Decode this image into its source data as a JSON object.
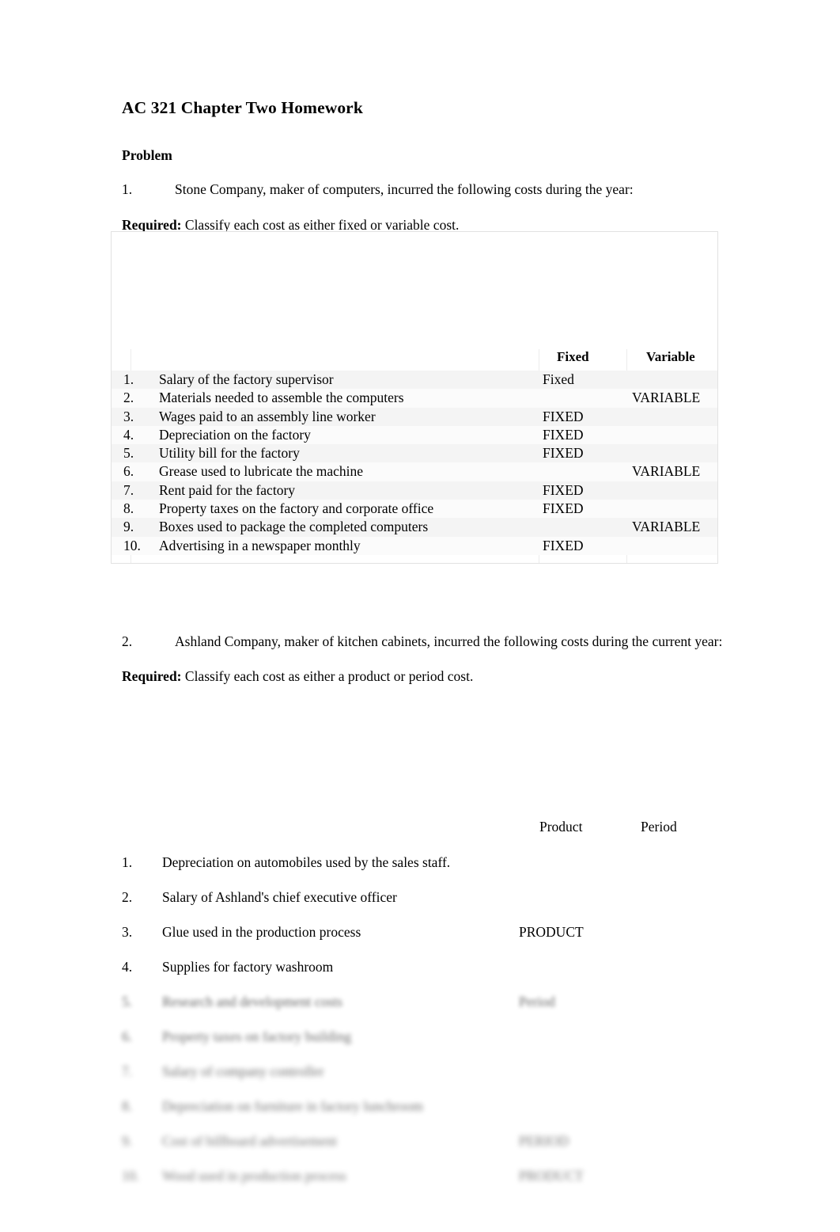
{
  "document": {
    "title": "AC 321 Chapter Two Homework",
    "section_label": "Problem"
  },
  "problem1": {
    "number": "1.",
    "prompt": "Stone Company, maker of computers, incurred the following costs during the year:",
    "required_label": "Required:",
    "required_text": " Classify each cost as either fixed or variable cost.",
    "table": {
      "columns": [
        "Fixed",
        "Variable"
      ],
      "rows": [
        {
          "num": "1.",
          "label": "Salary of the factory supervisor",
          "fixed": "Fixed",
          "variable": ""
        },
        {
          "num": "2.",
          "label": "Materials needed to assemble the computers",
          "fixed": "",
          "variable": "VARIABLE"
        },
        {
          "num": "3.",
          "label": "Wages paid to an assembly line worker",
          "fixed": "FIXED",
          "variable": ""
        },
        {
          "num": "4.",
          "label": "Depreciation on the factory",
          "fixed": "FIXED",
          "variable": ""
        },
        {
          "num": "5.",
          "label": "Utility bill for the factory",
          "fixed": "FIXED",
          "variable": ""
        },
        {
          "num": "6.",
          "label": "Grease used to lubricate the machine",
          "fixed": "",
          "variable": "VARIABLE"
        },
        {
          "num": "7.",
          "label": "Rent paid for the factory",
          "fixed": "FIXED",
          "variable": ""
        },
        {
          "num": "8.",
          "label": "Property taxes on the factory and corporate office",
          "fixed": "FIXED",
          "variable": ""
        },
        {
          "num": "9.",
          "label": "Boxes used to package the completed computers",
          "fixed": "",
          "variable": "VARIABLE"
        },
        {
          "num": "10.",
          "label": "Advertising in a newspaper monthly",
          "fixed": "FIXED",
          "variable": ""
        }
      ]
    }
  },
  "problem2": {
    "number": "2.",
    "prompt": "Ashland Company, maker of kitchen cabinets, incurred the following costs during the current year:",
    "required_label": "Required:",
    "required_text": " Classify each cost as either a product or period cost.",
    "columns": {
      "product": "Product",
      "period": "Period"
    },
    "items": [
      {
        "num": "1.",
        "label": "Depreciation on automobiles used by the sales staff.",
        "answer": ""
      },
      {
        "num": "2.",
        "label": "Salary of Ashland's chief executive officer",
        "answer": ""
      },
      {
        "num": "3.",
        "label": "Glue used in the production process",
        "answer": "PRODUCT"
      },
      {
        "num": "4.",
        "label": "Supplies for factory washroom",
        "answer": ""
      },
      {
        "num": "5.",
        "label": "Research and development costs",
        "answer": "Period"
      },
      {
        "num": "6.",
        "label": "Property taxes on factory building",
        "answer": ""
      },
      {
        "num": "7.",
        "label": "Salary of company controller",
        "answer": ""
      },
      {
        "num": "8.",
        "label": "Depreciation on furniture in factory lunchroom",
        "answer": ""
      },
      {
        "num": "9.",
        "label": "Cost of billboard advertisement",
        "answer": "PERIOD"
      },
      {
        "num": "10.",
        "label": "Wood used in production process",
        "answer": "PRODUCT"
      }
    ]
  }
}
